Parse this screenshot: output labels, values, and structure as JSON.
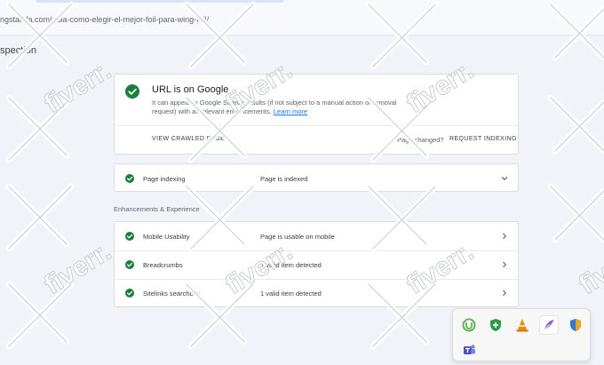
{
  "browser": {
    "url": "ngstarlifa.com/guia-como-elegir-el-mejor-foil-para-wing-foil/"
  },
  "page": {
    "title": "spection"
  },
  "status": {
    "headline": "URL is on Google",
    "description": "It can appear in Google Search results (if not subject to a manual action or removal request) with all relevant enhancements.",
    "learn_more": "Learn more",
    "view_crawled": "VIEW CRAWLED PAGE",
    "page_changed": "Page changed?",
    "request_indexing": "REQUEST INDEXING"
  },
  "indexing": {
    "name": "Page indexing",
    "value": "Page is indexed"
  },
  "enhancements": {
    "label": "Enhancements & Experience",
    "items": [
      {
        "name": "Mobile Usability",
        "value": "Page is usable on mobile"
      },
      {
        "name": "Breadcrumbs",
        "value": "1 valid item detected"
      },
      {
        "name": "Sitelinks searchbox",
        "value": "1 valid item detected"
      }
    ]
  },
  "tray": {
    "icons": [
      "utorrent-icon",
      "shield-plus-icon",
      "vlc-icon",
      "feather-pen-icon",
      "security-shield-icon",
      "teams-icon"
    ]
  },
  "watermark": {
    "text": "fiverr."
  },
  "colors": {
    "success": "#188038",
    "link": "#1a73e8",
    "background": "#f1f3f9"
  }
}
